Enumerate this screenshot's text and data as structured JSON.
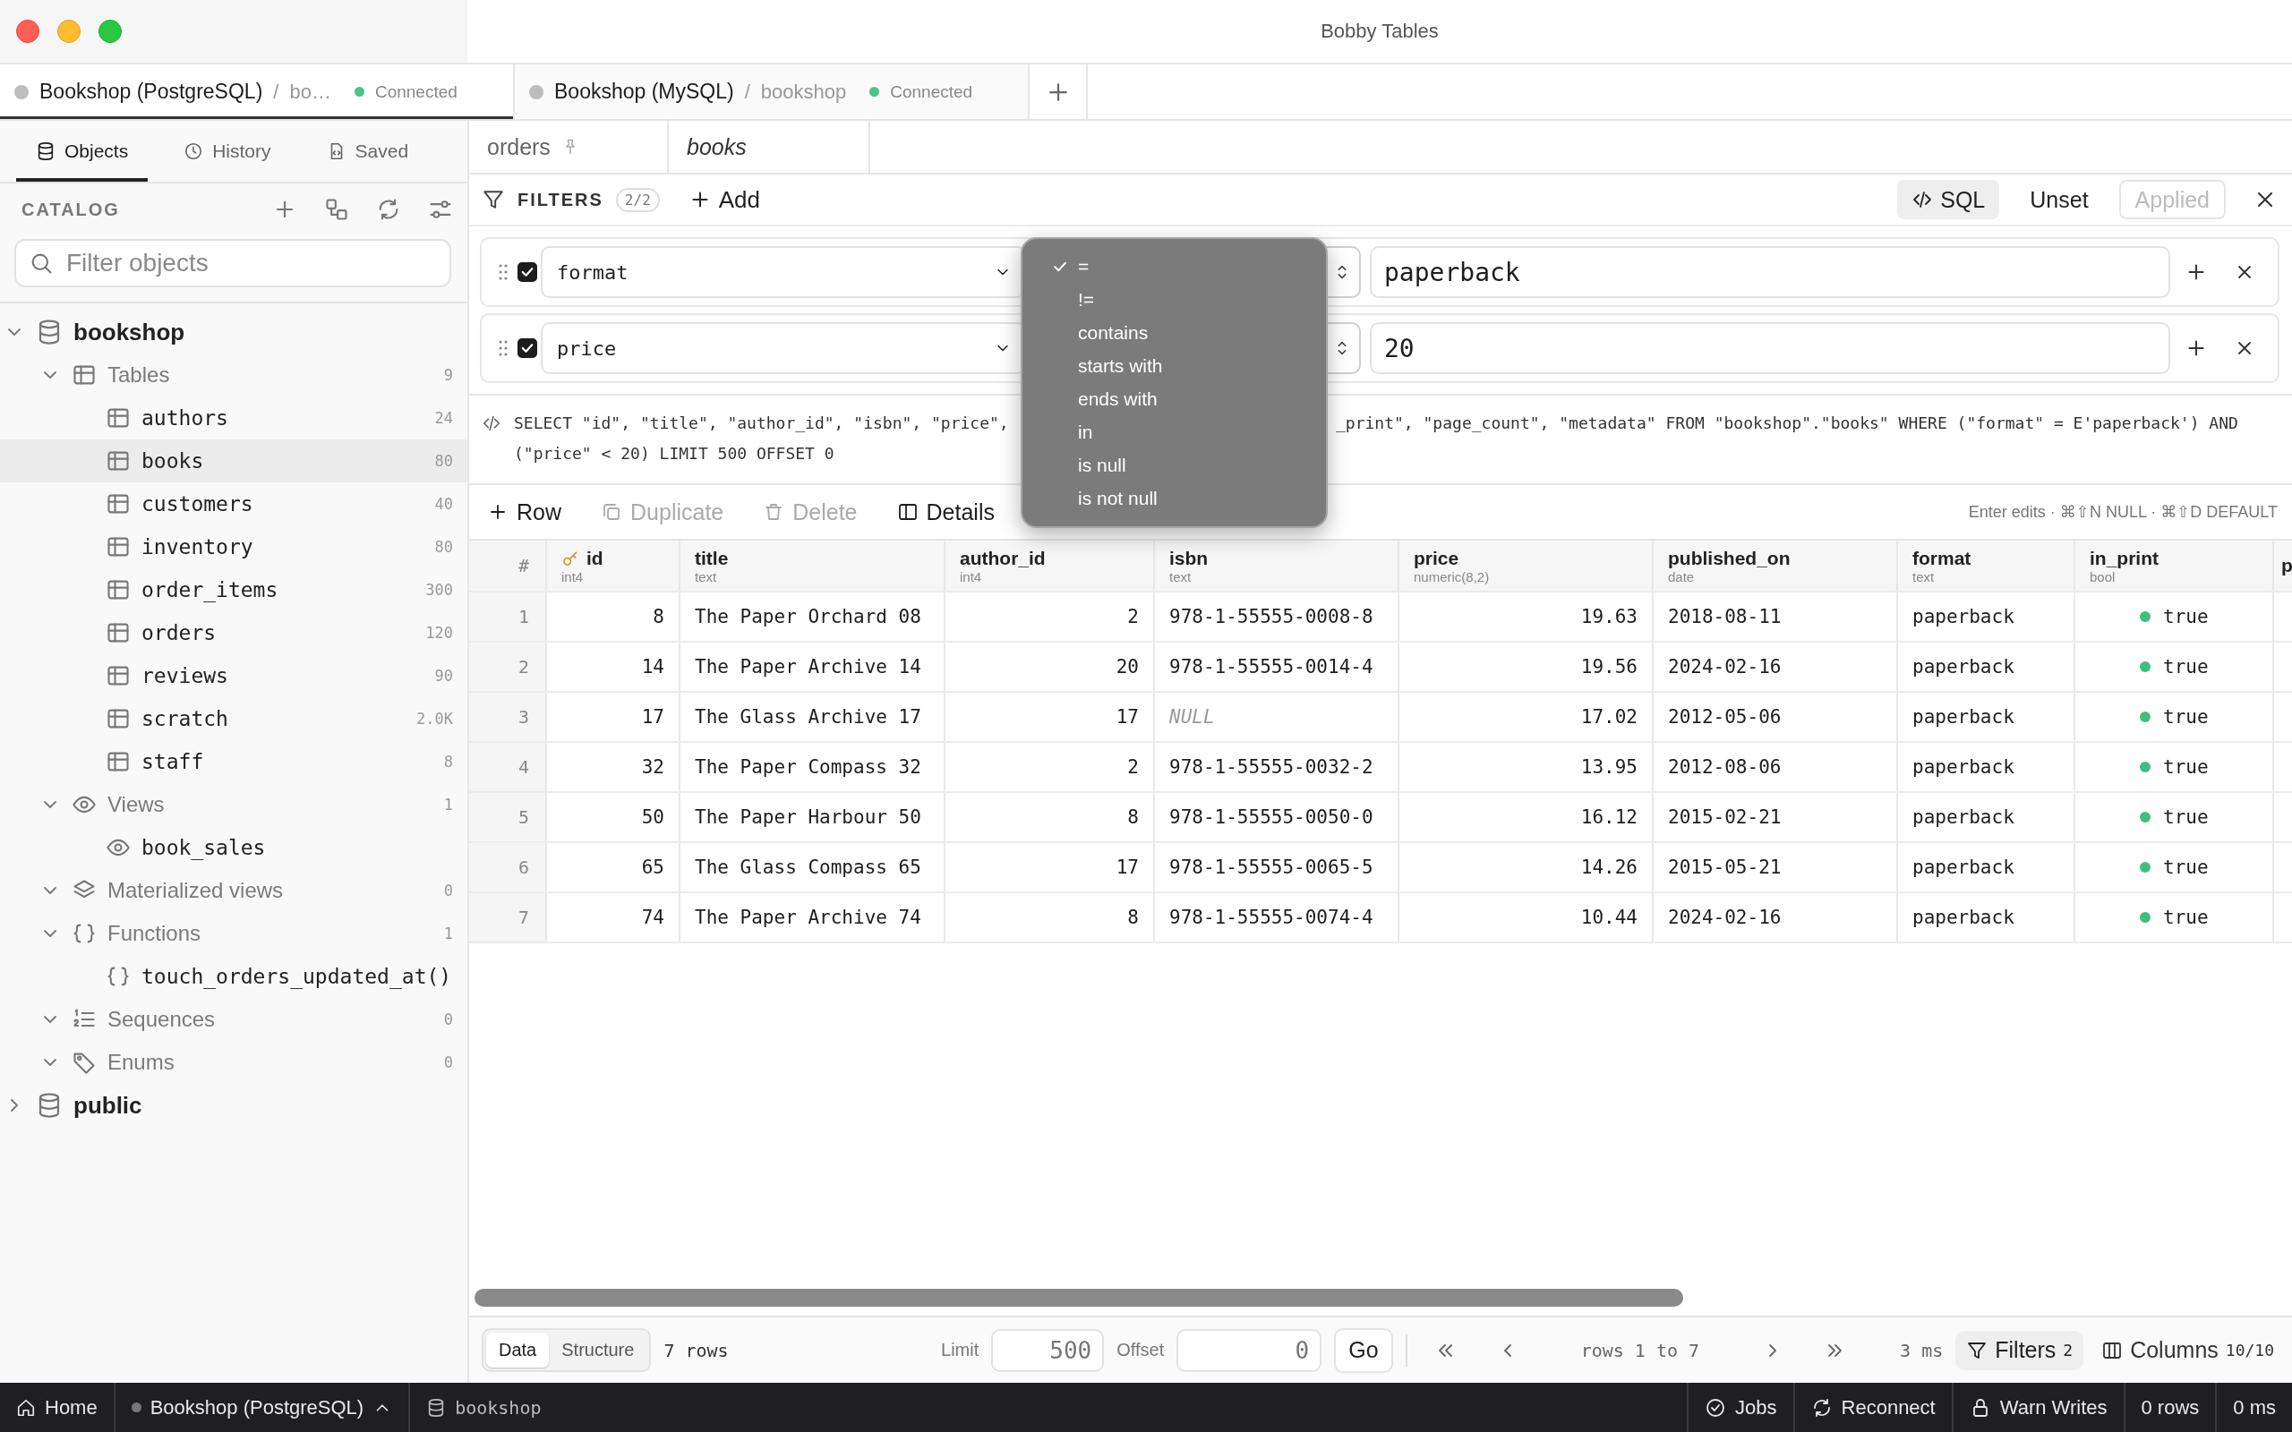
{
  "window": {
    "title": "Bobby Tables"
  },
  "connection_tabs": [
    {
      "name": "Bookshop (PostgreSQL)",
      "separator": "/",
      "database": "bo…",
      "status": "Connected",
      "selected": true
    },
    {
      "name": "Bookshop (MySQL)",
      "separator": "/",
      "database": "bookshop",
      "status": "Connected",
      "selected": false
    }
  ],
  "sidebar": {
    "tabs": [
      {
        "label": "Objects",
        "kind": "objects",
        "selected": true
      },
      {
        "label": "History",
        "kind": "history",
        "selected": false
      },
      {
        "label": "Saved",
        "kind": "saved",
        "selected": false
      }
    ],
    "section_title": "CATALOG",
    "search": {
      "placeholder": "Filter objects"
    },
    "tree": [
      {
        "label": "bookshop",
        "kind": "schema",
        "expanded": true,
        "selected": false,
        "children": [
          {
            "label": "Tables",
            "kind": "tables",
            "count": "9",
            "expanded": true,
            "selected": false,
            "children": [
              {
                "label": "authors",
                "kind": "table",
                "count": "24",
                "selected": false
              },
              {
                "label": "books",
                "kind": "table",
                "count": "80",
                "selected": true
              },
              {
                "label": "customers",
                "kind": "table",
                "count": "40",
                "selected": false
              },
              {
                "label": "inventory",
                "kind": "table",
                "count": "80",
                "selected": false
              },
              {
                "label": "order_items",
                "kind": "table",
                "count": "300",
                "selected": false
              },
              {
                "label": "orders",
                "kind": "table",
                "count": "120",
                "selected": false
              },
              {
                "label": "reviews",
                "kind": "table",
                "count": "90",
                "selected": false
              },
              {
                "label": "scratch",
                "kind": "table",
                "count": "2.0K",
                "selected": false
              },
              {
                "label": "staff",
                "kind": "table",
                "count": "8",
                "selected": false
              }
            ]
          },
          {
            "label": "Views",
            "kind": "views",
            "count": "1",
            "expanded": true,
            "selected": false,
            "children": [
              {
                "label": "book_sales",
                "kind": "view",
                "selected": false
              }
            ]
          },
          {
            "label": "Materialized views",
            "kind": "matviews",
            "count": "0",
            "expanded": true,
            "selected": false
          },
          {
            "label": "Functions",
            "kind": "functions",
            "count": "1",
            "expanded": true,
            "selected": false,
            "children": [
              {
                "label": "touch_orders_updated_at()",
                "kind": "function",
                "selected": false
              }
            ]
          },
          {
            "label": "Sequences",
            "kind": "sequences",
            "count": "0",
            "expanded": true,
            "selected": false
          },
          {
            "label": "Enums",
            "kind": "enums",
            "count": "0",
            "expanded": true,
            "selected": false
          }
        ]
      },
      {
        "label": "public",
        "kind": "schema",
        "expanded": false,
        "selected": false
      }
    ]
  },
  "editor_tabs": [
    {
      "label": "orders",
      "pinned": true,
      "preview": false
    },
    {
      "label": "books",
      "pinned": false,
      "preview": true
    }
  ],
  "filters": {
    "title": "FILTERS",
    "count": "2/2",
    "add": "Add",
    "sql_button": "SQL",
    "unset": "Unset",
    "applied": {
      "label": "Applied",
      "disabled": true
    },
    "rows": [
      {
        "enabled": true,
        "column": "format",
        "value": "paperback"
      },
      {
        "enabled": true,
        "column": "price",
        "value": "20"
      }
    ]
  },
  "operator_menu": {
    "options": [
      {
        "label": "=",
        "selected": true
      },
      {
        "label": "!=",
        "selected": false
      },
      {
        "label": "contains",
        "selected": false
      },
      {
        "label": "starts with",
        "selected": false
      },
      {
        "label": "ends with",
        "selected": false
      },
      {
        "label": "in",
        "selected": false
      },
      {
        "label": "is null",
        "selected": false
      },
      {
        "label": "is not null",
        "selected": false
      }
    ]
  },
  "sql_preview": {
    "line_1_start": "SELECT \"id\", \"title\", \"author_id\", \"isbn\", \"price\",",
    "line_1_end": "_print\", \"page_count\", \"metadata\" FROM \"bookshop\".\"books\" WHERE (\"format\" = E'paperback') AND",
    "line_2": "(\"price\" < 20) LIMIT 500 OFFSET 0"
  },
  "toolbar": {
    "buttons": [
      {
        "label": "Row",
        "kind": "add",
        "disabled": false
      },
      {
        "label": "Duplicate",
        "kind": "duplicate",
        "disabled": true
      },
      {
        "label": "Delete",
        "kind": "delete",
        "disabled": true
      },
      {
        "label": "Details",
        "kind": "details",
        "disabled": false
      }
    ],
    "hint": "Enter edits · ⌘⇧N NULL · ⌘⇧D DEFAULT"
  },
  "table": {
    "row_number_heading": "#",
    "columns": [
      {
        "name": "id",
        "type": "int4",
        "kind": "number",
        "primary_key": true
      },
      {
        "name": "title",
        "type": "text",
        "kind": "text",
        "primary_key": false
      },
      {
        "name": "author_id",
        "type": "int4",
        "kind": "number",
        "primary_key": false
      },
      {
        "name": "isbn",
        "type": "text",
        "kind": "text",
        "primary_key": false
      },
      {
        "name": "price",
        "type": "numeric(8,2)",
        "kind": "number",
        "primary_key": false
      },
      {
        "name": "published_on",
        "type": "date",
        "kind": "text",
        "primary_key": false
      },
      {
        "name": "format",
        "type": "text",
        "kind": "text",
        "primary_key": false
      },
      {
        "name": "in_print",
        "type": "bool",
        "kind": "bool",
        "primary_key": false
      },
      {
        "name": "p",
        "kind": "text",
        "primary_key": false
      }
    ],
    "rows": [
      {
        "number": "1",
        "cells": [
          "8",
          "The Paper Orchard 08",
          "2",
          "978-1-55555-0008-8",
          "19.63",
          "2018-08-11",
          "paperback",
          "true"
        ]
      },
      {
        "number": "2",
        "cells": [
          "14",
          "The Paper Archive 14",
          "20",
          "978-1-55555-0014-4",
          "19.56",
          "2024-02-16",
          "paperback",
          "true"
        ]
      },
      {
        "number": "3",
        "cells": [
          "17",
          "The Glass Archive 17",
          "17",
          {
            "text": "NULL",
            "null": true
          },
          "17.02",
          "2012-05-06",
          "paperback",
          "true"
        ]
      },
      {
        "number": "4",
        "cells": [
          "32",
          "The Paper Compass 32",
          "2",
          "978-1-55555-0032-2",
          "13.95",
          "2012-08-06",
          "paperback",
          "true"
        ]
      },
      {
        "number": "5",
        "cells": [
          "50",
          "The Paper Harbour 50",
          "8",
          "978-1-55555-0050-0",
          "16.12",
          "2015-02-21",
          "paperback",
          "true"
        ]
      },
      {
        "number": "6",
        "cells": [
          "65",
          "The Glass Compass 65",
          "17",
          "978-1-55555-0065-5",
          "14.26",
          "2015-05-21",
          "paperback",
          "true"
        ]
      },
      {
        "number": "7",
        "cells": [
          "74",
          "The Paper Archive 74",
          "8",
          "978-1-55555-0074-4",
          "10.44",
          "2024-02-16",
          "paperback",
          "true"
        ]
      }
    ]
  },
  "footer": {
    "views": [
      {
        "label": "Data",
        "selected": true
      },
      {
        "label": "Structure",
        "selected": false
      }
    ],
    "row_count": "7 rows",
    "limit": {
      "label": "Limit",
      "placeholder": "500"
    },
    "offset": {
      "label": "Offset",
      "placeholder": "0"
    },
    "go": "Go",
    "range": "rows 1 to 7",
    "timing": "3 ms",
    "filters": {
      "label": "Filters",
      "count": "2"
    },
    "columns": {
      "label": "Columns",
      "count": "10/10"
    }
  },
  "status_bar": {
    "home": "Home",
    "connection": "Bookshop (PostgreSQL)",
    "database": "bookshop",
    "items": [
      {
        "label": "Jobs",
        "kind": "jobs"
      },
      {
        "label": "Reconnect",
        "kind": "reconnect"
      },
      {
        "label": "Warn Writes",
        "kind": "lock"
      },
      {
        "label": "0 rows",
        "kind": "text"
      },
      {
        "label": "0 ms",
        "kind": "text"
      }
    ]
  }
}
